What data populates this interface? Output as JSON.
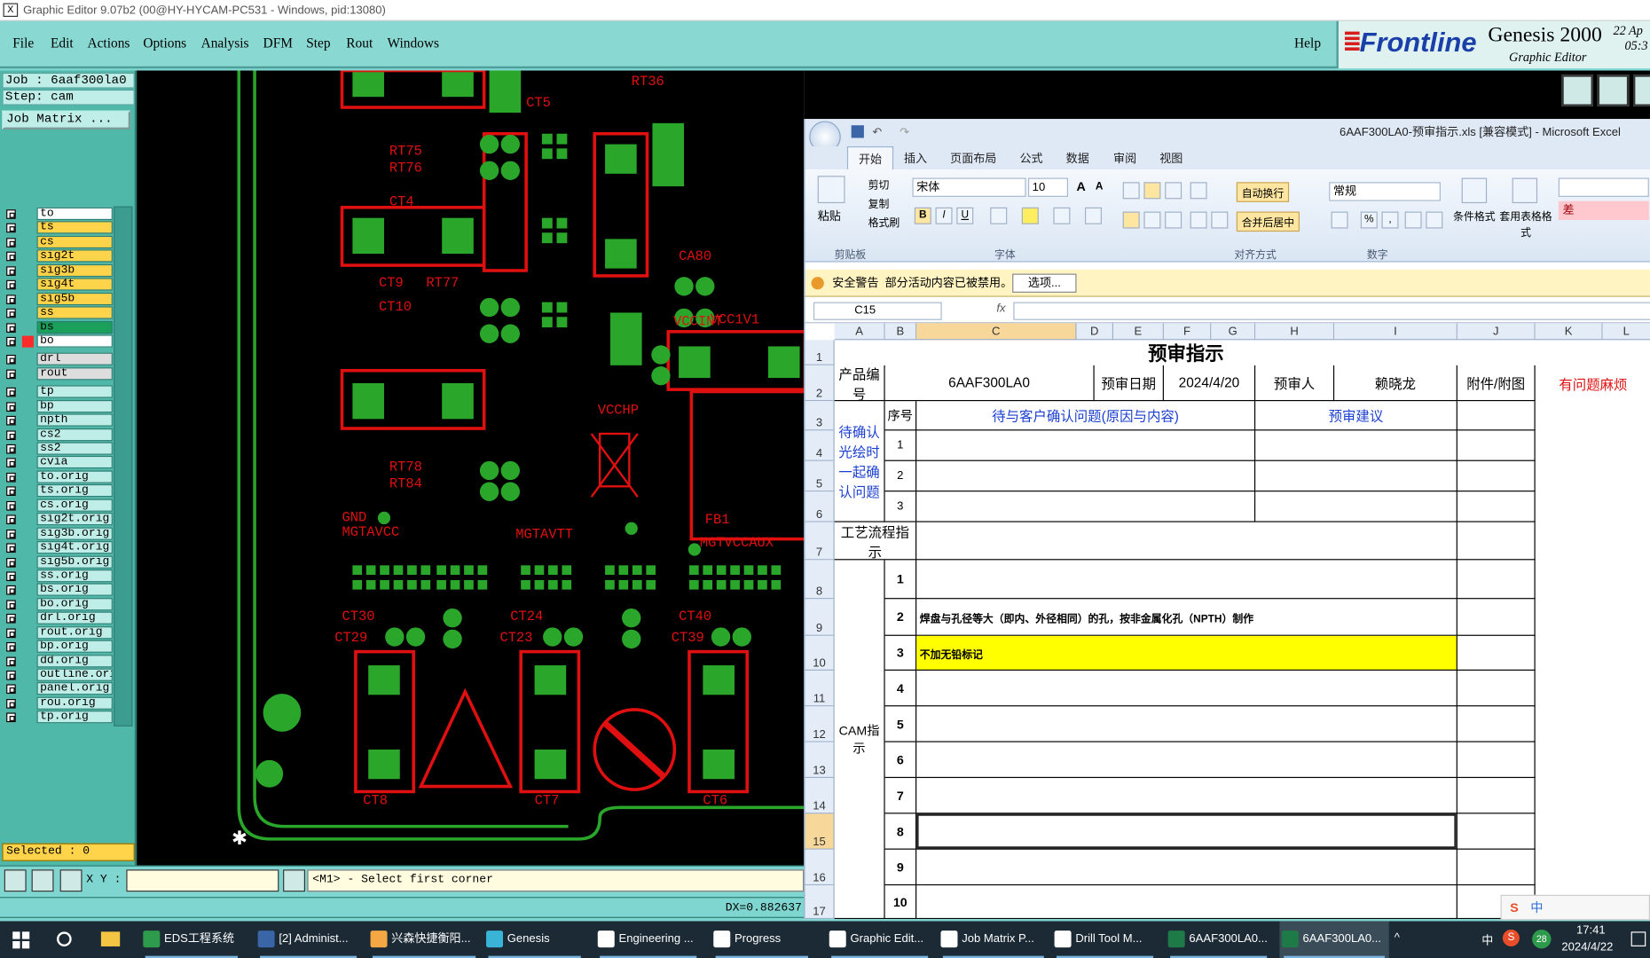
{
  "genesis": {
    "window_title": "Graphic Editor 9.07b2 (00@HY-HYCAM-PC531 - Windows, pid:13080)",
    "title_icon": "X",
    "menu": [
      "File",
      "Edit",
      "Actions",
      "Options",
      "Analysis",
      "DFM",
      "Step",
      "Rout",
      "Windows"
    ],
    "help": "Help",
    "brand": {
      "logo": "Frontline",
      "product": "Genesis 2000",
      "subtitle": "Graphic Editor",
      "clock_frag": "22 Ap",
      "clock_frag2": "05:3"
    },
    "job_line": "Job : 6aaf300la0",
    "step_line": "Step: cam",
    "job_matrix_button": "Job Matrix ...",
    "layers": [
      {
        "name": "to",
        "color": "#ffffff"
      },
      {
        "name": "ts",
        "color": "#ffd34a"
      },
      {
        "name": "cs",
        "color": "#ffd34a"
      },
      {
        "name": "sig2t",
        "color": "#ffd34a"
      },
      {
        "name": "sig3b",
        "color": "#ffd34a"
      },
      {
        "name": "sig4t",
        "color": "#ffd34a"
      },
      {
        "name": "sig5b",
        "color": "#ffd34a"
      },
      {
        "name": "ss",
        "color": "#ffd34a"
      },
      {
        "name": "bs",
        "color": "#1aa05a"
      },
      {
        "name": "bo",
        "color": "#ffffff",
        "marker": "#ff2a2a"
      },
      {
        "name": "drl",
        "color": "#dddddd",
        "gap": true
      },
      {
        "name": "rout",
        "color": "#dddddd"
      },
      {
        "name": "tp",
        "color": "#bfeee8",
        "gap": true
      },
      {
        "name": "bp",
        "color": "#bfeee8"
      },
      {
        "name": "npth",
        "color": "#bfeee8"
      },
      {
        "name": "cs2",
        "color": "#bfeee8"
      },
      {
        "name": "ss2",
        "color": "#bfeee8"
      },
      {
        "name": "cvia",
        "color": "#bfeee8"
      },
      {
        "name": "to.orig",
        "color": "#bfeee8"
      },
      {
        "name": "ts.orig",
        "color": "#bfeee8"
      },
      {
        "name": "cs.orig",
        "color": "#bfeee8"
      },
      {
        "name": "sig2t.orig",
        "color": "#bfeee8"
      },
      {
        "name": "sig3b.orig",
        "color": "#bfeee8"
      },
      {
        "name": "sig4t.orig",
        "color": "#bfeee8"
      },
      {
        "name": "sig5b.orig",
        "color": "#bfeee8"
      },
      {
        "name": "ss.orig",
        "color": "#bfeee8"
      },
      {
        "name": "bs.orig",
        "color": "#bfeee8"
      },
      {
        "name": "bo.orig",
        "color": "#bfeee8"
      },
      {
        "name": "drl.orig",
        "color": "#bfeee8"
      },
      {
        "name": "rout.orig",
        "color": "#bfeee8"
      },
      {
        "name": "bp.orig",
        "color": "#bfeee8"
      },
      {
        "name": "dd.orig",
        "color": "#bfeee8"
      },
      {
        "name": "outline.orig",
        "color": "#bfeee8"
      },
      {
        "name": "panel.orig",
        "color": "#bfeee8"
      },
      {
        "name": "rou.orig",
        "color": "#bfeee8"
      },
      {
        "name": "tp.orig",
        "color": "#bfeee8"
      }
    ],
    "selected": "Selected : 0",
    "xy_label": "X Y :",
    "status": "<M1> - Select first corner",
    "dx": "DX=0.882637",
    "pcb_labels": [
      "RT36",
      "CT5",
      "RT75",
      "RT76",
      "CT4",
      "CT9",
      "RT77",
      "CT10",
      "CT8",
      "CT7",
      "CT6",
      "CT30",
      "CT29",
      "CT24",
      "CT23",
      "CT40",
      "CT39",
      "VCCHP",
      "CA80",
      "VCC1V1",
      "VCCINT",
      "GND",
      "MGTAVCC",
      "MGTAVTT",
      "MGTVCCAUX",
      "FB1",
      "RT78",
      "RT84"
    ]
  },
  "excel": {
    "title": "6AAF300LA0-预审指示.xls  [兼容模式] - Microsoft Excel",
    "tabs": [
      "开始",
      "插入",
      "页面布局",
      "公式",
      "数据",
      "审阅",
      "视图"
    ],
    "clipboard": {
      "paste": "粘贴",
      "cut": "剪切",
      "copy": "复制",
      "format": "格式刷",
      "group": "剪贴板"
    },
    "font": {
      "name": "宋体",
      "size": "10",
      "group": "字体",
      "bold": "B",
      "italic": "I",
      "underline": "U",
      "grow": "A",
      "shrink": "A"
    },
    "align": {
      "wrap": "自动换行",
      "merge": "合并后居中",
      "group": "对齐方式"
    },
    "number": {
      "format": "常规",
      "group": "数字",
      "percent": "%",
      "comma": ","
    },
    "styles": {
      "cond": "条件格式",
      "table": "套用表格格式",
      "bad": "差"
    },
    "security": {
      "label": "安全警告",
      "msg": "部分活动内容已被禁用。",
      "button": "选项..."
    },
    "namebox": "C15",
    "fx": "fx",
    "col_headers": [
      "A",
      "B",
      "C",
      "D",
      "E",
      "F",
      "G",
      "H",
      "I",
      "J",
      "K",
      "L"
    ],
    "row_headers": [
      "1",
      "2",
      "3",
      "4",
      "5",
      "6",
      "7",
      "8",
      "9",
      "10",
      "11",
      "12",
      "13",
      "14",
      "15",
      "16",
      "17"
    ],
    "sheet": {
      "title": "预审指示",
      "product_no_label": "产品编号",
      "product_no": "6AAF300LA0",
      "date_label": "预审日期",
      "date": "2024/4/20",
      "reviewer_label": "预审人",
      "reviewer": "赖晓龙",
      "attach_label": "附件/附图",
      "trouble": "有问题麻烦",
      "seq_label": "序号",
      "question_header": "待与客户确认问题(原因与内容)",
      "suggest_header": "预审建议",
      "confirm_label": "待确认光绘时一起确认问题",
      "process_label": "工艺流程指示",
      "cam_label": "CAM指示",
      "q_rows": [
        "1",
        "2",
        "3"
      ],
      "cam_rows": [
        "1",
        "2",
        "3",
        "4",
        "5",
        "6",
        "7",
        "8",
        "9",
        "10"
      ],
      "cam_text_2": "焊盘与孔径等大（即内、外径相同）的孔，按非金属化孔（NPTH）制作",
      "cam_text_3": "不加无铅标记"
    }
  },
  "taskbar": {
    "items": [
      "EDS工程系统",
      "[2] Administ...",
      "兴森快捷衡阳...",
      "Genesis",
      "Engineering ...",
      "Progress",
      "Graphic Edit...",
      "Job Matrix P...",
      "Drill Tool M...",
      "6AAF300LA0...",
      "6AAF300LA0..."
    ],
    "ime": "中",
    "badge": "28",
    "time": "17:41",
    "date": "2024/4/22",
    "tray_s": "S"
  }
}
